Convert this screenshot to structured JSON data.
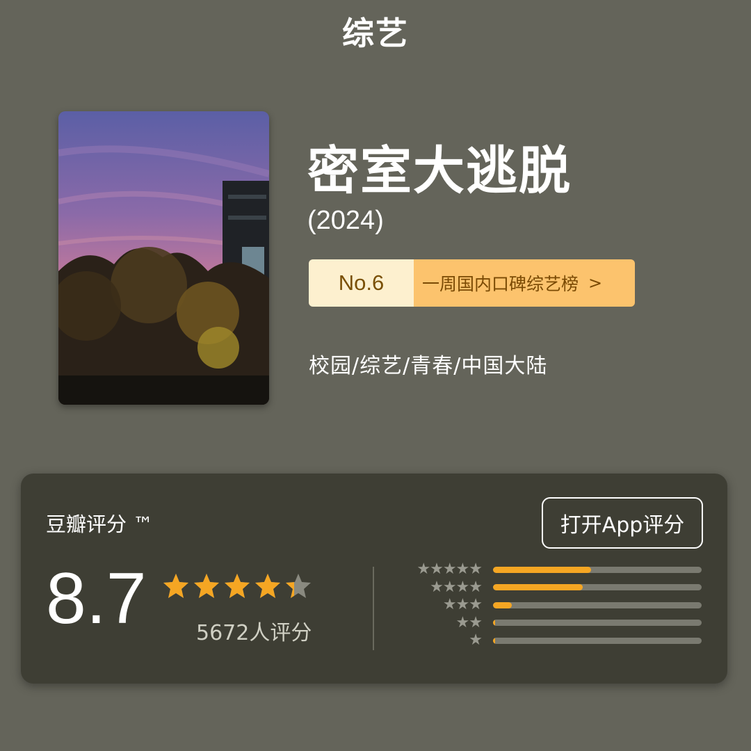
{
  "header": {
    "category_title": "综艺"
  },
  "show": {
    "title": "密室大逃脱",
    "year": "(2024)",
    "genres": "校园/综艺/青春/中国大陆"
  },
  "rank": {
    "number": "No.6",
    "list_name": "一周国内口碑综艺榜",
    "chevron": ">"
  },
  "rating": {
    "brand": "豆瓣评分 ™",
    "open_app_label": "打开App评分",
    "score": "8.7",
    "stars_value": 4.35,
    "count_text": "5672人评分",
    "distribution": [
      {
        "stars": 5,
        "fraction": 0.47
      },
      {
        "stars": 4,
        "fraction": 0.43
      },
      {
        "stars": 3,
        "fraction": 0.09
      },
      {
        "stars": 2,
        "fraction": 0.01
      },
      {
        "stars": 1,
        "fraction": 0.01
      }
    ]
  },
  "colors": {
    "background": "#64645a",
    "card": "#3e3e34",
    "accent": "#f5a623",
    "badge_light": "#fdf0cf",
    "badge_dark": "#fcc36d"
  },
  "icons": {
    "star": "star-icon",
    "half_star": "half-star-icon"
  }
}
